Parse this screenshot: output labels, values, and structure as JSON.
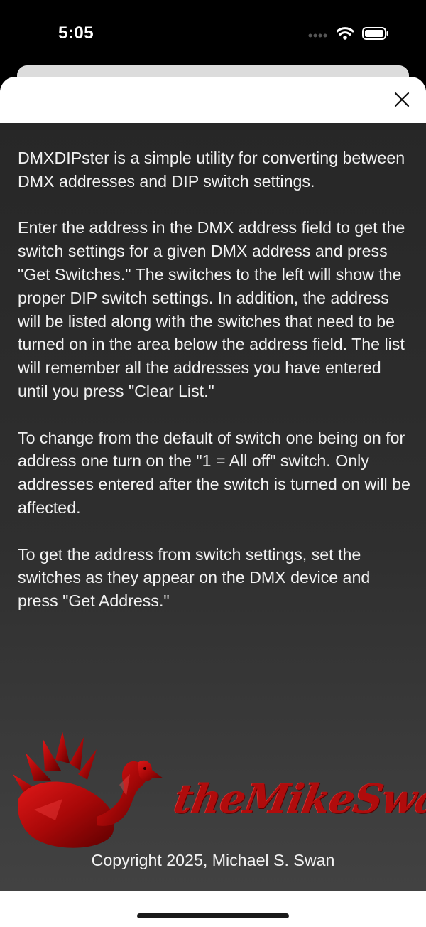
{
  "status_bar": {
    "time": "5:05",
    "icons": [
      "signal-dots-icon",
      "wifi-icon",
      "battery-icon"
    ]
  },
  "sheet": {
    "close_icon": "close-icon",
    "paragraphs": [
      "DMXDIPster is a simple utility for converting between DMX addresses and DIP switch settings.",
      "Enter the address in the DMX address field to get the switch settings for a given DMX address and press \"Get Switches.\" The switches to the left will show the proper DIP switch settings. In addition, the address will be listed along with the switches that need to be turned on in the area below the address field. The list will remember all the addresses you have entered until you press \"Clear List.\"",
      "To change from the default of switch one being on for address one turn on the \"1 = All off\" switch. Only addresses entered after the switch is turned on will be affected.",
      "To get the address from switch settings, set the switches as they appear on the DMX device and press \"Get Address.\""
    ],
    "logo_text": "theMikeSwan",
    "copyright": "Copyright 2025, Michael S. Swan"
  },
  "colors": {
    "logo_red": "#b00c0c",
    "text": "#f2f2f2"
  }
}
